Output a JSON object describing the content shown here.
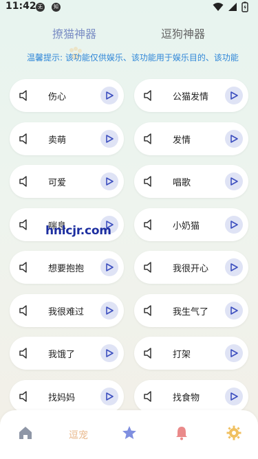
{
  "status": {
    "time": "11:42",
    "badge_1": "无",
    "badge_2": "知"
  },
  "tabs": {
    "active": "撩猫神器",
    "inactive": "逗狗神器"
  },
  "notice": "温馨提示: 该功能仅供娱乐、该功能用于娱乐目的、该功能",
  "sounds": [
    {
      "label": "伤心"
    },
    {
      "label": "公猫发情"
    },
    {
      "label": "卖萌"
    },
    {
      "label": "发情"
    },
    {
      "label": "可爱"
    },
    {
      "label": "唱歌"
    },
    {
      "label": "喘息"
    },
    {
      "label": "小奶猫"
    },
    {
      "label": "想要抱抱"
    },
    {
      "label": "我很开心"
    },
    {
      "label": "我很难过"
    },
    {
      "label": "我生气了"
    },
    {
      "label": "我饿了"
    },
    {
      "label": "打架"
    },
    {
      "label": "找妈妈"
    },
    {
      "label": "找食物"
    }
  ],
  "watermark": "hnlcjr.com",
  "bottom_nav": {
    "home_icon": "home-icon",
    "tease_label": "逗宠",
    "star_icon": "star-icon",
    "bell_icon": "bell-icon",
    "gear_icon": "gear-icon"
  },
  "colors": {
    "accent": "#7c8fc5",
    "notice": "#2f86d8",
    "play_bg": "#dfe3f5",
    "nav_text": "#e9b98d"
  }
}
